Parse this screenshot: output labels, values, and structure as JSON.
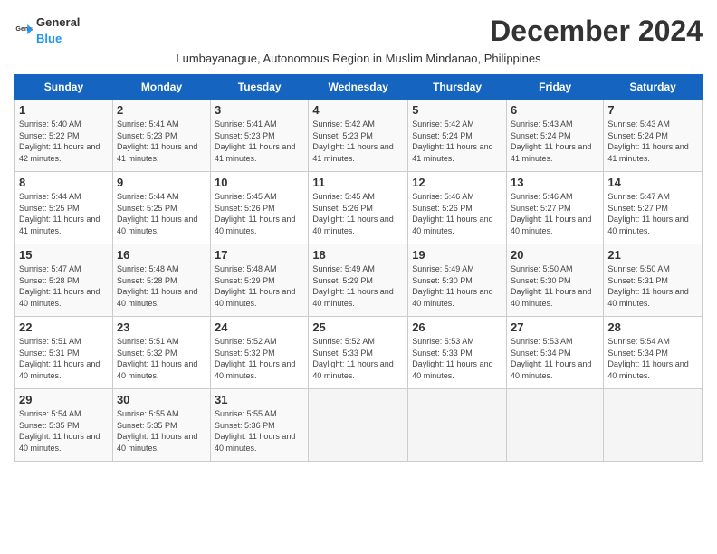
{
  "logo": {
    "general": "General",
    "blue": "Blue"
  },
  "title": "December 2024",
  "subtitle": "Lumbayanague, Autonomous Region in Muslim Mindanao, Philippines",
  "headers": [
    "Sunday",
    "Monday",
    "Tuesday",
    "Wednesday",
    "Thursday",
    "Friday",
    "Saturday"
  ],
  "weeks": [
    [
      {
        "day": "1",
        "sunrise": "5:40 AM",
        "sunset": "5:22 PM",
        "daylight": "11 hours and 42 minutes."
      },
      {
        "day": "2",
        "sunrise": "5:41 AM",
        "sunset": "5:23 PM",
        "daylight": "11 hours and 41 minutes."
      },
      {
        "day": "3",
        "sunrise": "5:41 AM",
        "sunset": "5:23 PM",
        "daylight": "11 hours and 41 minutes."
      },
      {
        "day": "4",
        "sunrise": "5:42 AM",
        "sunset": "5:23 PM",
        "daylight": "11 hours and 41 minutes."
      },
      {
        "day": "5",
        "sunrise": "5:42 AM",
        "sunset": "5:24 PM",
        "daylight": "11 hours and 41 minutes."
      },
      {
        "day": "6",
        "sunrise": "5:43 AM",
        "sunset": "5:24 PM",
        "daylight": "11 hours and 41 minutes."
      },
      {
        "day": "7",
        "sunrise": "5:43 AM",
        "sunset": "5:24 PM",
        "daylight": "11 hours and 41 minutes."
      }
    ],
    [
      {
        "day": "8",
        "sunrise": "5:44 AM",
        "sunset": "5:25 PM",
        "daylight": "11 hours and 41 minutes."
      },
      {
        "day": "9",
        "sunrise": "5:44 AM",
        "sunset": "5:25 PM",
        "daylight": "11 hours and 40 minutes."
      },
      {
        "day": "10",
        "sunrise": "5:45 AM",
        "sunset": "5:26 PM",
        "daylight": "11 hours and 40 minutes."
      },
      {
        "day": "11",
        "sunrise": "5:45 AM",
        "sunset": "5:26 PM",
        "daylight": "11 hours and 40 minutes."
      },
      {
        "day": "12",
        "sunrise": "5:46 AM",
        "sunset": "5:26 PM",
        "daylight": "11 hours and 40 minutes."
      },
      {
        "day": "13",
        "sunrise": "5:46 AM",
        "sunset": "5:27 PM",
        "daylight": "11 hours and 40 minutes."
      },
      {
        "day": "14",
        "sunrise": "5:47 AM",
        "sunset": "5:27 PM",
        "daylight": "11 hours and 40 minutes."
      }
    ],
    [
      {
        "day": "15",
        "sunrise": "5:47 AM",
        "sunset": "5:28 PM",
        "daylight": "11 hours and 40 minutes."
      },
      {
        "day": "16",
        "sunrise": "5:48 AM",
        "sunset": "5:28 PM",
        "daylight": "11 hours and 40 minutes."
      },
      {
        "day": "17",
        "sunrise": "5:48 AM",
        "sunset": "5:29 PM",
        "daylight": "11 hours and 40 minutes."
      },
      {
        "day": "18",
        "sunrise": "5:49 AM",
        "sunset": "5:29 PM",
        "daylight": "11 hours and 40 minutes."
      },
      {
        "day": "19",
        "sunrise": "5:49 AM",
        "sunset": "5:30 PM",
        "daylight": "11 hours and 40 minutes."
      },
      {
        "day": "20",
        "sunrise": "5:50 AM",
        "sunset": "5:30 PM",
        "daylight": "11 hours and 40 minutes."
      },
      {
        "day": "21",
        "sunrise": "5:50 AM",
        "sunset": "5:31 PM",
        "daylight": "11 hours and 40 minutes."
      }
    ],
    [
      {
        "day": "22",
        "sunrise": "5:51 AM",
        "sunset": "5:31 PM",
        "daylight": "11 hours and 40 minutes."
      },
      {
        "day": "23",
        "sunrise": "5:51 AM",
        "sunset": "5:32 PM",
        "daylight": "11 hours and 40 minutes."
      },
      {
        "day": "24",
        "sunrise": "5:52 AM",
        "sunset": "5:32 PM",
        "daylight": "11 hours and 40 minutes."
      },
      {
        "day": "25",
        "sunrise": "5:52 AM",
        "sunset": "5:33 PM",
        "daylight": "11 hours and 40 minutes."
      },
      {
        "day": "26",
        "sunrise": "5:53 AM",
        "sunset": "5:33 PM",
        "daylight": "11 hours and 40 minutes."
      },
      {
        "day": "27",
        "sunrise": "5:53 AM",
        "sunset": "5:34 PM",
        "daylight": "11 hours and 40 minutes."
      },
      {
        "day": "28",
        "sunrise": "5:54 AM",
        "sunset": "5:34 PM",
        "daylight": "11 hours and 40 minutes."
      }
    ],
    [
      {
        "day": "29",
        "sunrise": "5:54 AM",
        "sunset": "5:35 PM",
        "daylight": "11 hours and 40 minutes."
      },
      {
        "day": "30",
        "sunrise": "5:55 AM",
        "sunset": "5:35 PM",
        "daylight": "11 hours and 40 minutes."
      },
      {
        "day": "31",
        "sunrise": "5:55 AM",
        "sunset": "5:36 PM",
        "daylight": "11 hours and 40 minutes."
      },
      null,
      null,
      null,
      null
    ]
  ],
  "labels": {
    "sunrise": "Sunrise: ",
    "sunset": "Sunset: ",
    "daylight": "Daylight: "
  }
}
